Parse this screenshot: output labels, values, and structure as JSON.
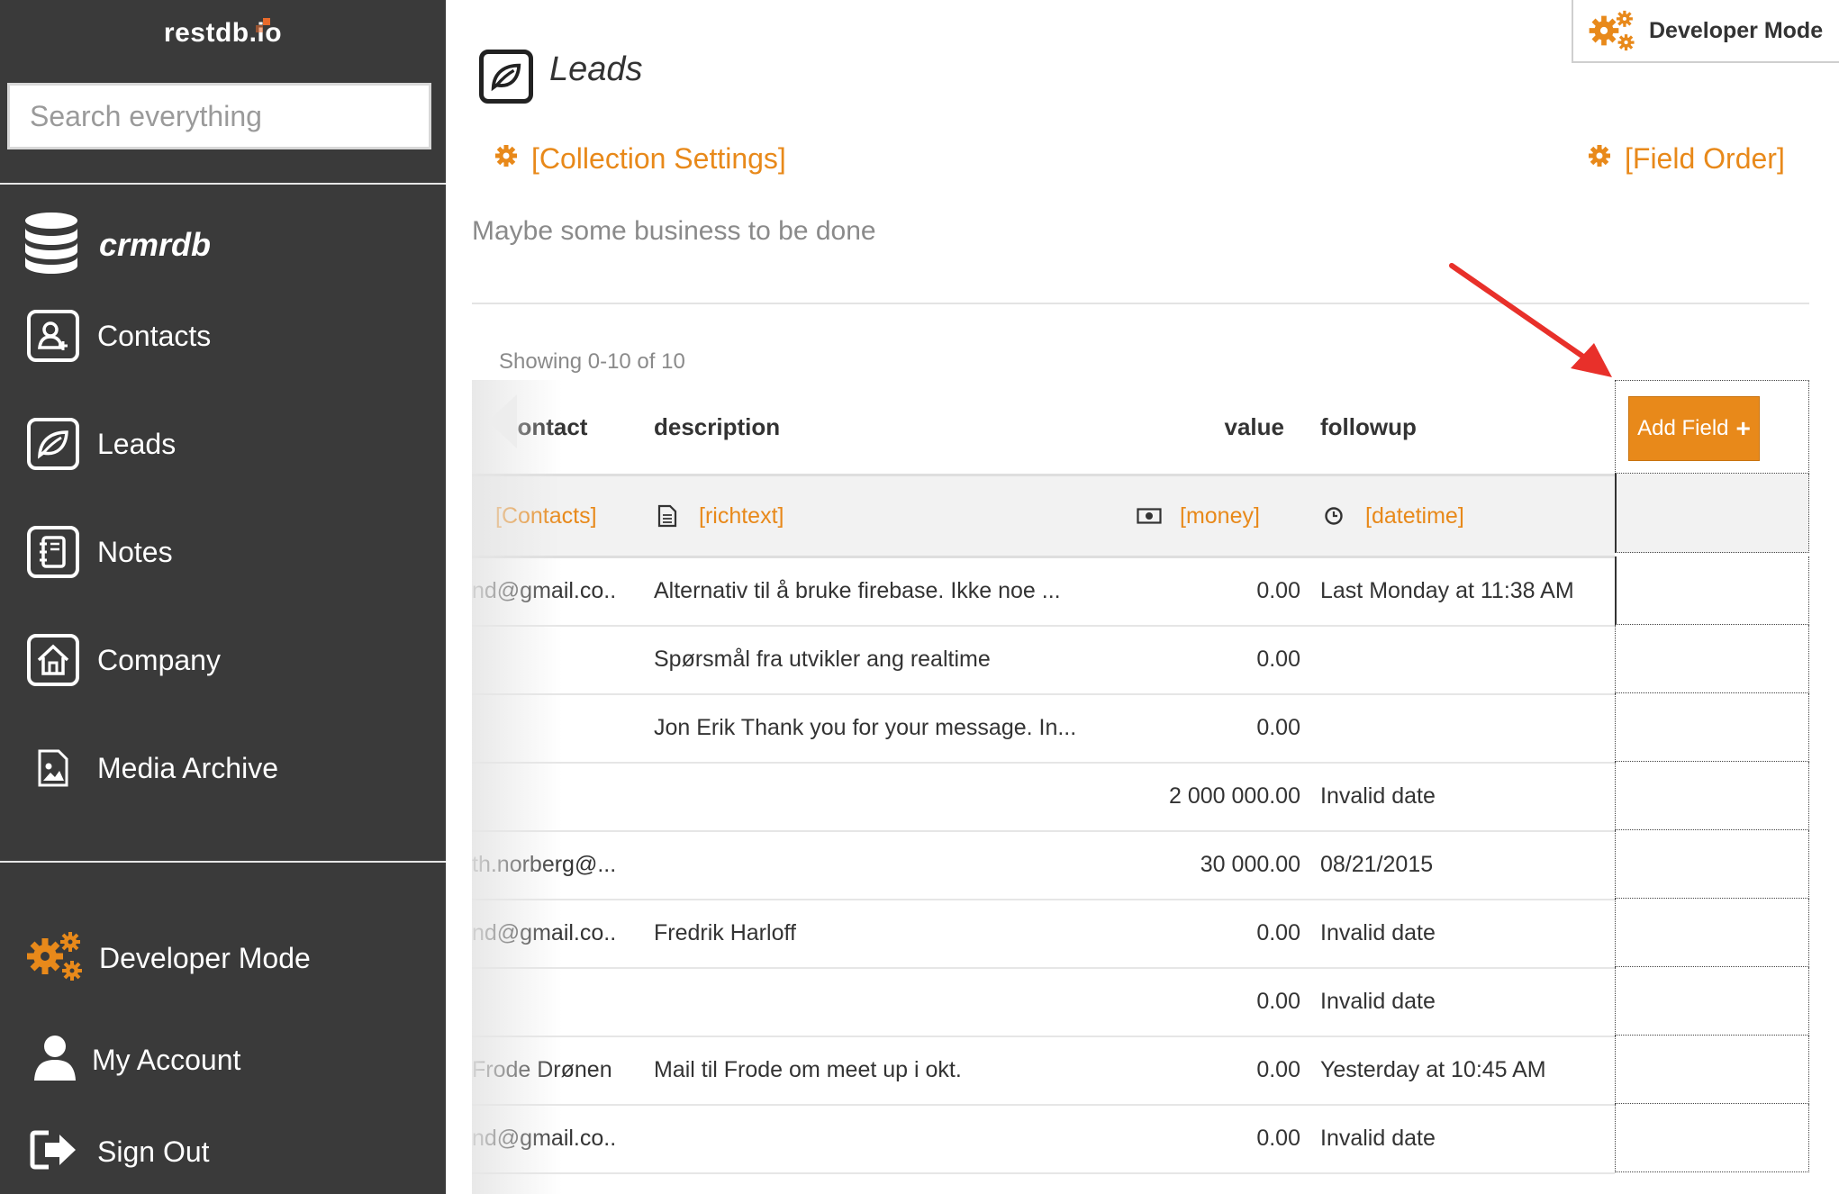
{
  "sidebar": {
    "brand": "restdb.io",
    "search_placeholder": "Search everything",
    "database": "crmrdb",
    "items": [
      {
        "label": "Contacts"
      },
      {
        "label": "Leads"
      },
      {
        "label": "Notes"
      },
      {
        "label": "Company"
      },
      {
        "label": "Media Archive"
      }
    ],
    "bottom": {
      "developer_mode": "Developer Mode",
      "my_account": "My Account",
      "sign_out": "Sign Out"
    }
  },
  "header": {
    "developer_mode_button": "Developer Mode",
    "title": "Leads",
    "collection_settings": "[Collection Settings]",
    "field_order": "[Field Order]",
    "description": "Maybe some business to be done"
  },
  "table": {
    "showing": "Showing 0-10 of 10",
    "columns": [
      {
        "name": "contact",
        "type": "[Contacts]"
      },
      {
        "name": "description",
        "type": "[richtext]"
      },
      {
        "name": "value",
        "type": "[money]"
      },
      {
        "name": "followup",
        "type": "[datetime]"
      }
    ],
    "add_field": "Add Field",
    "rows": [
      {
        "contact": "nd@gmail.co...",
        "description": "Alternativ til å bruke firebase. Ikke noe ...",
        "value": "0.00",
        "followup": "Last Monday at 11:38 AM"
      },
      {
        "contact": "",
        "description": "Spørsmål fra utvikler ang realtime",
        "value": "0.00",
        "followup": ""
      },
      {
        "contact": "",
        "description": "Jon Erik Thank you for your message. In...",
        "value": "0.00",
        "followup": ""
      },
      {
        "contact": "",
        "description": "",
        "value": "2 000 000.00",
        "followup": "Invalid date"
      },
      {
        "contact": "th.norberg@...",
        "description": "",
        "value": "30 000.00",
        "followup": "08/21/2015"
      },
      {
        "contact": "nd@gmail.co...",
        "description": "Fredrik Harloff",
        "value": "0.00",
        "followup": "Invalid date"
      },
      {
        "contact": "",
        "description": "",
        "value": "0.00",
        "followup": "Invalid date"
      },
      {
        "contact": "Frode Drønen",
        "description": "Mail til Frode om meet up i okt.",
        "value": "0.00",
        "followup": "Yesterday at 10:45 AM"
      },
      {
        "contact": "nd@gmail.co...",
        "description": "",
        "value": "0.00",
        "followup": "Invalid date"
      }
    ]
  },
  "colors": {
    "sidebar_bg": "#3a3a3a",
    "accent_orange": "#e8891a",
    "annotation_arrow": "#e8302a"
  },
  "icons": [
    "database-icon",
    "contacts-icon",
    "leaf-icon",
    "notebook-icon",
    "home-icon",
    "image-file-icon",
    "gears-icon",
    "user-icon",
    "sign-out-icon",
    "gear-icon",
    "document-icon",
    "money-icon",
    "clock-icon",
    "plus-icon",
    "arrow-left-icon"
  ]
}
